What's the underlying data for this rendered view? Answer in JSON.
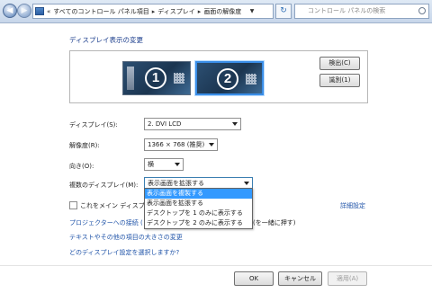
{
  "address": {
    "prefix": "«",
    "crumbs": [
      "すべてのコントロール パネル項目",
      "ディスプレイ",
      "画面の解像度"
    ],
    "separator": "▸",
    "search_placeholder": "コントロール パネルの検索"
  },
  "heading": "ディスプレイ表示の変更",
  "monitors": [
    {
      "number": "1",
      "selected": false
    },
    {
      "number": "2",
      "selected": true
    }
  ],
  "buttons": {
    "detect": "検出(C)",
    "identify": "識別(1)",
    "ok": "OK",
    "cancel": "キャンセル",
    "apply": "適用(A)"
  },
  "fields": {
    "display_label": "ディスプレイ(S):",
    "display_value": "2. DVI LCD",
    "resolution_label": "解像度(R):",
    "resolution_value": "1366 × 768 (推奨)",
    "orientation_label": "向き(O):",
    "orientation_value": "横",
    "multi_label": "複数のディスプレイ(M):",
    "multi_value": "表示画面を拡張する"
  },
  "multi_options": [
    "表示画面を複製する",
    "表示画面を拡張する",
    "デスクトップを 1 のみに表示する",
    "デスクトップを 2 のみに表示する"
  ],
  "highlighted_option_index": 0,
  "main_display_label": "これをメイン ディスプ",
  "advanced_link": "詳細設定",
  "links": {
    "projector": "プロジェクターへの接続 (",
    "projector_tail": "(を一緒に押す)",
    "text_size": "テキストやその他の項目の大きさの変更",
    "which_setting": "どのディスプレイ設定を選択しますか?"
  },
  "colors": {
    "link": "#1f53a8",
    "highlight": "#3399ff"
  }
}
